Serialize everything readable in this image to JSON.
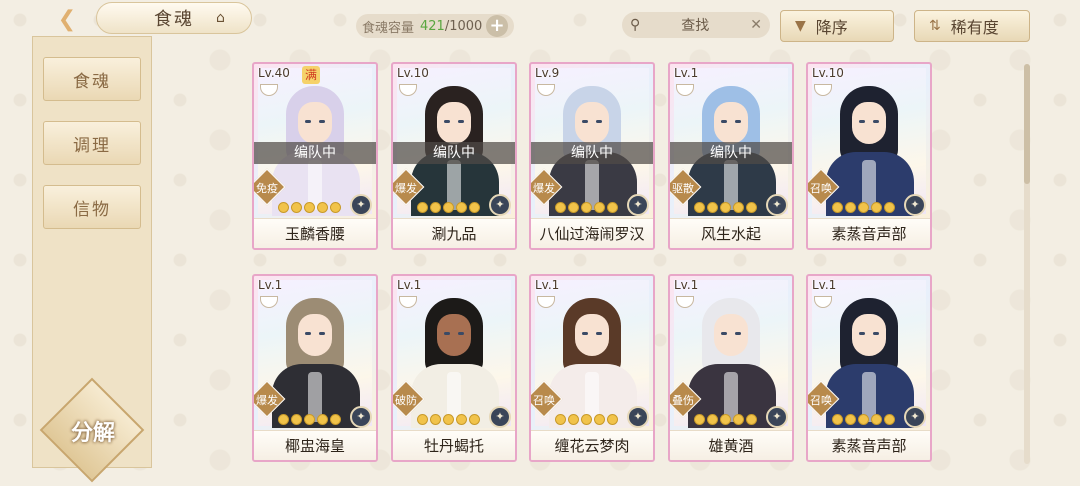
{
  "header": {
    "back_icon": "back-arrow-icon",
    "title": "食魂",
    "title_icon": "house-icon",
    "capacity_label": "食魂容量",
    "capacity_current": "421",
    "capacity_max": "/1000",
    "add_label": "+",
    "search_placeholder": "查找",
    "search_clear": "✕",
    "sort_order_label": "降序",
    "sort_field_label": "稀有度"
  },
  "sidebar": {
    "tabs": [
      {
        "label": "食魂",
        "active": true
      },
      {
        "label": "调理",
        "active": false
      },
      {
        "label": "信物",
        "active": false
      }
    ],
    "decompose_label": "分解"
  },
  "colors": {
    "accent_teal": "#a8dad4",
    "gold": "#f1c34a",
    "card_border": "#e8a6c8"
  },
  "cards": [
    {
      "level": "Lv.40",
      "cap": "满",
      "team": "编队中",
      "role": "免疫",
      "stars": 5,
      "name": "玉麟香腰",
      "hair": "#d8d0ea",
      "outfit": "#e9e2f2",
      "skin": "light"
    },
    {
      "level": "Lv.10",
      "cap": "",
      "team": "编队中",
      "role": "爆发",
      "stars": 5,
      "name": "涮九品",
      "hair": "#2a2220",
      "outfit": "#26353a",
      "skin": "light"
    },
    {
      "level": "Lv.9",
      "cap": "",
      "team": "编队中",
      "role": "爆发",
      "stars": 5,
      "name": "八仙过海闹罗汉",
      "hair": "#c8d4e8",
      "outfit": "#3a3a44",
      "skin": "light"
    },
    {
      "level": "Lv.1",
      "cap": "",
      "team": "编队中",
      "role": "驱散",
      "stars": 5,
      "name": "风生水起",
      "hair": "#9ebfe6",
      "outfit": "#2e3a48",
      "skin": "light"
    },
    {
      "level": "Lv.10",
      "cap": "",
      "team": "",
      "role": "召唤",
      "stars": 5,
      "name": "素蒸音声部",
      "hair": "#1e2230",
      "outfit": "#2c3c6c",
      "skin": "light"
    },
    {
      "level": "Lv.1",
      "cap": "",
      "team": "",
      "role": "爆发",
      "stars": 5,
      "name": "椰盅海皇",
      "hair": "#9c8c74",
      "outfit": "#2e2e34",
      "skin": "light"
    },
    {
      "level": "Lv.1",
      "cap": "",
      "team": "",
      "role": "破防",
      "stars": 5,
      "name": "牡丹蝎托",
      "hair": "#1c1a18",
      "outfit": "#f2eee4",
      "skin": "dark"
    },
    {
      "level": "Lv.1",
      "cap": "",
      "team": "",
      "role": "召唤",
      "stars": 5,
      "name": "缠花云梦肉",
      "hair": "#5a3a28",
      "outfit": "#f4ecea",
      "skin": "light"
    },
    {
      "level": "Lv.1",
      "cap": "",
      "team": "",
      "role": "叠伤",
      "stars": 5,
      "name": "雄黄酒",
      "hair": "#e8e8ec",
      "outfit": "#3a3440",
      "skin": "light"
    },
    {
      "level": "Lv.1",
      "cap": "",
      "team": "",
      "role": "召唤",
      "stars": 5,
      "name": "素蒸音声部",
      "hair": "#1e2230",
      "outfit": "#2c3c6c",
      "skin": "light"
    }
  ]
}
